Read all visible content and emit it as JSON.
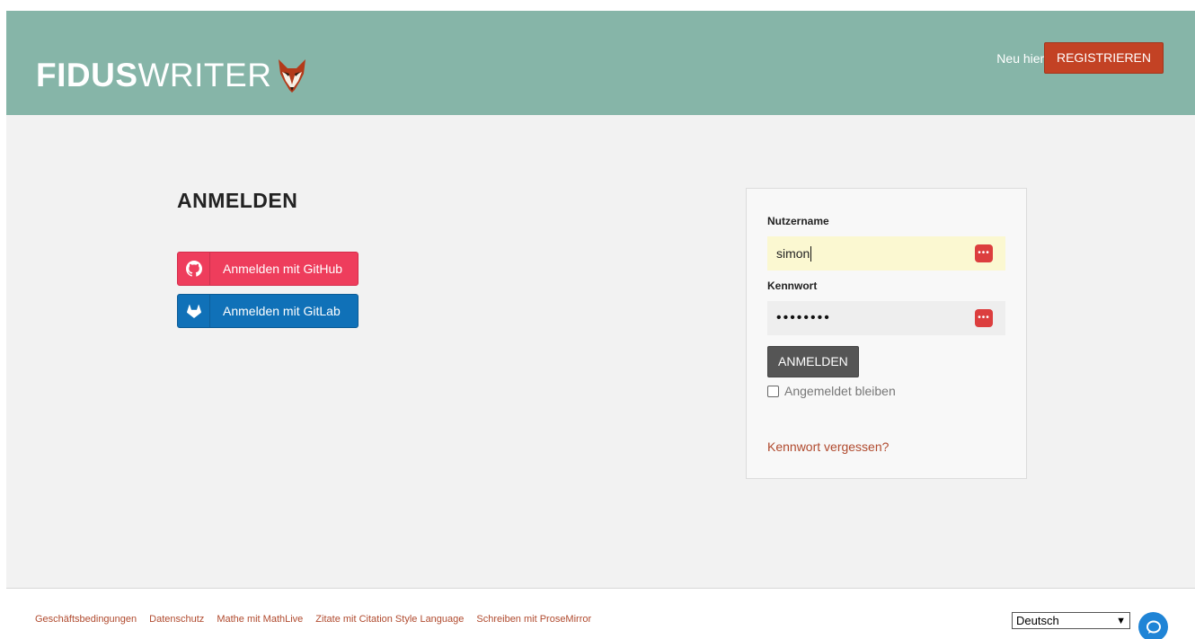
{
  "header": {
    "logo_bold": "FIDUS",
    "logo_light": "WRITER",
    "new_here": "Neu hier?",
    "register_label": "REGISTRIEREN",
    "bg_color": "#86b5a8",
    "accent_color": "#c34224"
  },
  "main": {
    "title": "ANMELDEN",
    "oauth": {
      "github_label": "Anmelden mit GitHub",
      "gitlab_label": "Anmelden mit GitLab",
      "github_color": "#ee3d5c",
      "gitlab_color": "#1071b8"
    },
    "form": {
      "username_label": "Nutzername",
      "username_value": "simon",
      "password_label": "Kennwort",
      "password_value": "••••••••",
      "password_manager_icon": "key-menu-icon",
      "submit_label": "ANMELDEN",
      "remember_label": "Angemeldet bleiben",
      "remember_checked": false,
      "forgot_label": "Kennwort vergessen?"
    }
  },
  "footer": {
    "links": [
      "Geschäftsbedingungen",
      "Datenschutz",
      "Mathe mit MathLive",
      "Zitate mit Citation Style Language",
      "Schreiben mit ProseMirror"
    ],
    "language_selected": "Deutsch",
    "chat_icon": "chat-bubble-icon"
  }
}
